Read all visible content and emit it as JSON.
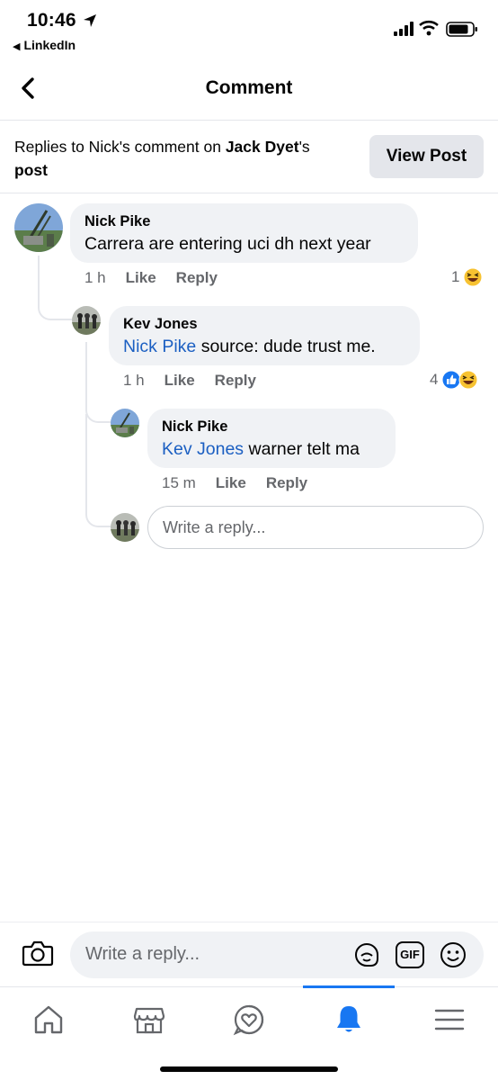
{
  "status_bar": {
    "time": "10:46",
    "back_app": "LinkedIn"
  },
  "header": {
    "title": "Comment"
  },
  "context": {
    "prefix": "Replies to Nick's comment on ",
    "author": "Jack Dyet",
    "suffix_after_author": "'s",
    "post_word": "post",
    "view_post_label": "View Post"
  },
  "comments": [
    {
      "name": "Nick Pike",
      "mention": "",
      "text": "Carrera are entering uci dh next year",
      "time": "1 h",
      "like": "Like",
      "reply": "Reply",
      "reaction_count": "1",
      "reactions": [
        "haha"
      ]
    },
    {
      "name": "Kev Jones",
      "mention": "Nick Pike",
      "text": " source: dude trust me.",
      "time": "1 h",
      "like": "Like",
      "reply": "Reply",
      "reaction_count": "4",
      "reactions": [
        "like",
        "haha"
      ]
    },
    {
      "name": "Nick Pike",
      "mention": "Kev Jones",
      "text": " warner telt ma",
      "time": "15 m",
      "like": "Like",
      "reply": "Reply",
      "reaction_count": "",
      "reactions": []
    }
  ],
  "reply_box": {
    "placeholder": "Write a reply..."
  },
  "composer": {
    "placeholder": "Write a reply...",
    "gif_label": "GIF"
  },
  "tabs": [
    {
      "name": "home",
      "icon": "home-icon"
    },
    {
      "name": "marketplace",
      "icon": "marketplace-icon"
    },
    {
      "name": "dating",
      "icon": "heart-bubble-icon"
    },
    {
      "name": "notifications",
      "icon": "bell-icon",
      "active": true
    },
    {
      "name": "menu",
      "icon": "menu-icon"
    }
  ],
  "colors": {
    "accent": "#1877f2",
    "mention": "#1b5fc2",
    "bubble": "#f0f2f5",
    "muted": "#65676b"
  }
}
